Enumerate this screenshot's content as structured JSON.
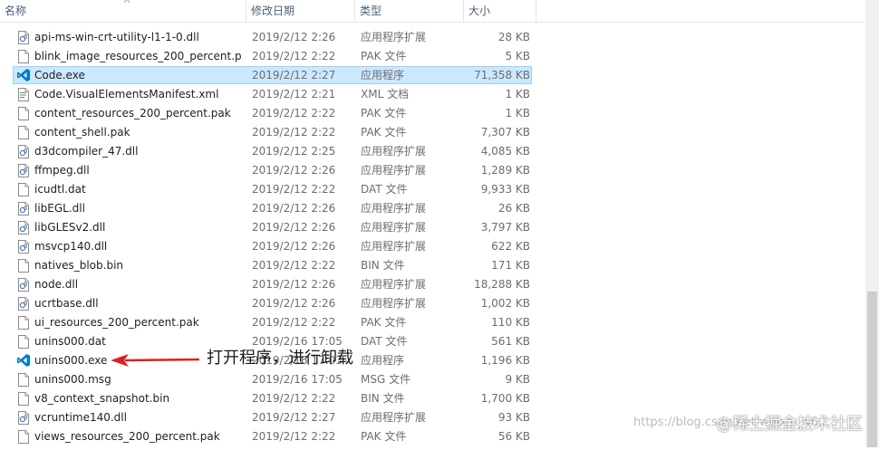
{
  "columns": {
    "name": "名称",
    "date": "修改日期",
    "type": "类型",
    "size": "大小"
  },
  "files": [
    {
      "name": "api-ms-win-crt-utility-l1-1-0.dll",
      "date": "2019/2/12 2:26",
      "type": "应用程序扩展",
      "size": "28 KB",
      "icon": "dll-icon"
    },
    {
      "name": "blink_image_resources_200_percent.p...",
      "date": "2019/2/12 2:22",
      "type": "PAK 文件",
      "size": "5 KB",
      "icon": "file-icon"
    },
    {
      "name": "Code.exe",
      "date": "2019/2/12 2:27",
      "type": "应用程序",
      "size": "71,358 KB",
      "icon": "vscode-icon",
      "selected": true
    },
    {
      "name": "Code.VisualElementsManifest.xml",
      "date": "2019/2/12 2:21",
      "type": "XML 文档",
      "size": "1 KB",
      "icon": "xml-icon"
    },
    {
      "name": "content_resources_200_percent.pak",
      "date": "2019/2/12 2:22",
      "type": "PAK 文件",
      "size": "1 KB",
      "icon": "file-icon"
    },
    {
      "name": "content_shell.pak",
      "date": "2019/2/12 2:22",
      "type": "PAK 文件",
      "size": "7,307 KB",
      "icon": "file-icon"
    },
    {
      "name": "d3dcompiler_47.dll",
      "date": "2019/2/12 2:25",
      "type": "应用程序扩展",
      "size": "4,085 KB",
      "icon": "dll-icon"
    },
    {
      "name": "ffmpeg.dll",
      "date": "2019/2/12 2:26",
      "type": "应用程序扩展",
      "size": "1,289 KB",
      "icon": "dll-icon"
    },
    {
      "name": "icudtl.dat",
      "date": "2019/2/12 2:22",
      "type": "DAT 文件",
      "size": "9,933 KB",
      "icon": "file-icon"
    },
    {
      "name": "libEGL.dll",
      "date": "2019/2/12 2:26",
      "type": "应用程序扩展",
      "size": "26 KB",
      "icon": "dll-icon"
    },
    {
      "name": "libGLESv2.dll",
      "date": "2019/2/12 2:26",
      "type": "应用程序扩展",
      "size": "3,797 KB",
      "icon": "dll-icon"
    },
    {
      "name": "msvcp140.dll",
      "date": "2019/2/12 2:26",
      "type": "应用程序扩展",
      "size": "622 KB",
      "icon": "dll-icon"
    },
    {
      "name": "natives_blob.bin",
      "date": "2019/2/12 2:22",
      "type": "BIN 文件",
      "size": "171 KB",
      "icon": "file-icon"
    },
    {
      "name": "node.dll",
      "date": "2019/2/12 2:26",
      "type": "应用程序扩展",
      "size": "18,288 KB",
      "icon": "dll-icon"
    },
    {
      "name": "ucrtbase.dll",
      "date": "2019/2/12 2:26",
      "type": "应用程序扩展",
      "size": "1,002 KB",
      "icon": "dll-icon"
    },
    {
      "name": "ui_resources_200_percent.pak",
      "date": "2019/2/12 2:22",
      "type": "PAK 文件",
      "size": "110 KB",
      "icon": "file-icon"
    },
    {
      "name": "unins000.dat",
      "date": "2019/2/16 17:05",
      "type": "DAT 文件",
      "size": "561 KB",
      "icon": "file-icon"
    },
    {
      "name": "unins000.exe",
      "date": "2019/2/16 17:03",
      "type": "应用程序",
      "size": "1,196 KB",
      "icon": "vscode-icon"
    },
    {
      "name": "unins000.msg",
      "date": "2019/2/16 17:05",
      "type": "MSG 文件",
      "size": "9 KB",
      "icon": "file-icon"
    },
    {
      "name": "v8_context_snapshot.bin",
      "date": "2019/2/12 2:22",
      "type": "BIN 文件",
      "size": "1,700 KB",
      "icon": "file-icon"
    },
    {
      "name": "vcruntime140.dll",
      "date": "2019/2/12 2:27",
      "type": "应用程序扩展",
      "size": "93 KB",
      "icon": "dll-icon"
    },
    {
      "name": "views_resources_200_percent.pak",
      "date": "2019/2/12 2:22",
      "type": "PAK 文件",
      "size": "56 KB",
      "icon": "file-icon"
    }
  ],
  "annotation": {
    "text": "打开程序，进行卸载",
    "color": "#e02020"
  },
  "watermark": {
    "url": "https://blog.csdn.net/weixin_46...",
    "brand": "@稀土掘金技术社区"
  },
  "colors": {
    "selection_bg": "#cce8ff",
    "selection_border": "#99d1ff",
    "header_text": "#4c607a",
    "vscode_blue": "#007acc"
  }
}
